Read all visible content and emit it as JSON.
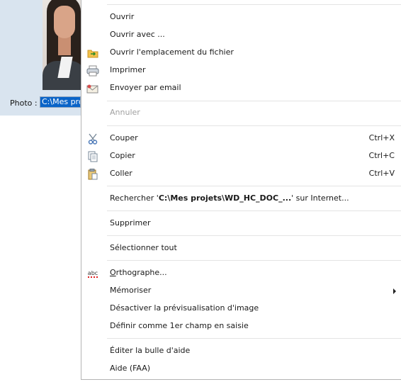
{
  "form": {
    "photo_label": "Photo :",
    "photo_value": "C:\\Mes proj"
  },
  "menu": {
    "open": "Ouvrir",
    "open_with": "Ouvrir avec ...",
    "open_location": "Ouvrir l'emplacement du fichier",
    "print": "Imprimer",
    "send_email": "Envoyer par email",
    "undo": "Annuler",
    "cut": "Couper",
    "cut_shortcut": "Ctrl+X",
    "copy": "Copier",
    "copy_shortcut": "Ctrl+C",
    "paste": "Coller",
    "paste_shortcut": "Ctrl+V",
    "search_prefix": "Rechercher '",
    "search_term": "C:\\Mes projets\\WD_HC_DOC_...",
    "search_suffix": "' sur Internet...",
    "delete": "Supprimer",
    "select_all": "Sélectionner tout",
    "spelling": "Orthographe...",
    "memorize": "Mémoriser",
    "disable_preview": "Désactiver la prévisualisation d'image",
    "set_first_field": "Définir comme 1er champ en saisie",
    "edit_tooltip": "Éditer la bulle d'aide",
    "help": "Aide (FAA)",
    "spelling_icon_text": "abc"
  },
  "icons": {
    "open_location": "folder-icon",
    "print": "printer-icon",
    "send_email": "envelope-icon",
    "cut": "scissors-icon",
    "copy": "copy-icon",
    "paste": "clipboard-icon",
    "spelling": "spellcheck-icon"
  },
  "colors": {
    "selection": "#0a64c8",
    "form_background": "#d9e4ef",
    "disabled_text": "#a0a0a0"
  }
}
